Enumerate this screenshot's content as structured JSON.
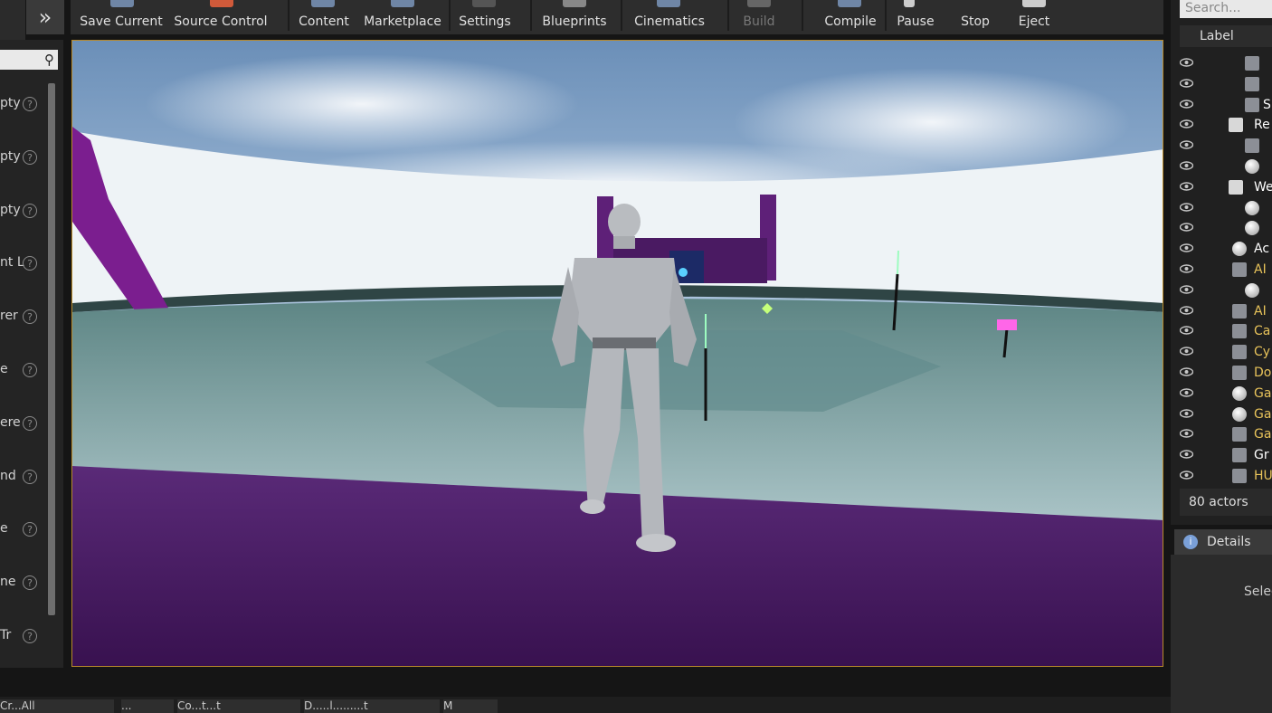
{
  "toolbar": {
    "items": [
      {
        "label": "Save Current"
      },
      {
        "label": "Source Control"
      },
      {
        "label": "Content"
      },
      {
        "label": "Marketplace"
      },
      {
        "label": "Settings"
      },
      {
        "label": "Blueprints"
      },
      {
        "label": "Cinematics"
      },
      {
        "label": "Build",
        "disabled": true
      },
      {
        "label": "Compile"
      },
      {
        "label": "Pause"
      },
      {
        "label": "Stop"
      },
      {
        "label": "Eject"
      }
    ],
    "expand_icon": "double-chevron-right-icon"
  },
  "details_panel": {
    "rows": [
      {
        "label": "pty"
      },
      {
        "label": "pty"
      },
      {
        "label": "pty"
      },
      {
        "label": "nt L"
      },
      {
        "label": "rer"
      },
      {
        "label": "e"
      },
      {
        "label": "ere"
      },
      {
        "label": "nd"
      },
      {
        "label": "e"
      },
      {
        "label": "ne"
      },
      {
        "label": "Tr"
      }
    ],
    "help_glyph": "?"
  },
  "outliner": {
    "search_placeholder": "Search...",
    "column_label": "Label",
    "rows": [
      {
        "text": "",
        "color": "#ffffff",
        "icon": "actor-cube-icon"
      },
      {
        "text": "",
        "color": "#ffffff",
        "icon": "actor-cube-icon"
      },
      {
        "text": "S",
        "color": "#ffffff",
        "icon": "sky-light-icon"
      },
      {
        "text": "Re",
        "color": "#ffffff",
        "icon": "folder-icon"
      },
      {
        "text": "",
        "color": "#ffffff",
        "icon": "directional-light-icon"
      },
      {
        "text": "",
        "color": "#ffffff",
        "icon": "sphere-reflection-icon"
      },
      {
        "text": "We",
        "color": "#ffffff",
        "icon": "folder-icon"
      },
      {
        "text": "",
        "color": "#ffffff",
        "icon": "sphere-icon"
      },
      {
        "text": "",
        "color": "#ffffff",
        "icon": "sphere-icon"
      },
      {
        "text": "Ac",
        "color": "#ffffff",
        "icon": "actor-sphere-icon"
      },
      {
        "text": "AI",
        "color": "#e8c35a",
        "icon": "ai-icon"
      },
      {
        "text": "",
        "color": "#ffffff",
        "icon": "sphere-icon"
      },
      {
        "text": "AI",
        "color": "#e8c35a",
        "icon": "ai-controller-icon"
      },
      {
        "text": "Ca",
        "color": "#e8c35a",
        "icon": "camera-icon"
      },
      {
        "text": "Cy",
        "color": "#e8c35a",
        "icon": "cylinder-icon"
      },
      {
        "text": "Do",
        "color": "#e8c35a",
        "icon": "document-icon"
      },
      {
        "text": "Ga",
        "color": "#e8c35a",
        "icon": "actor-sphere-icon"
      },
      {
        "text": "Ga",
        "color": "#e8c35a",
        "icon": "actor-sphere-icon"
      },
      {
        "text": "Ga",
        "color": "#e8c35a",
        "icon": "graph-icon"
      },
      {
        "text": "Gr",
        "color": "#ffffff",
        "icon": "gear-icon"
      },
      {
        "text": "HU",
        "color": "#e8c35a",
        "icon": "hud-icon"
      }
    ],
    "actor_count": "80 actors"
  },
  "details": {
    "tab_label": "Details",
    "empty_message": "Selec"
  },
  "bottom_tabs": [
    {
      "label": "Cr...All"
    },
    {
      "label": "..."
    },
    {
      "label": "Co...t...t"
    },
    {
      "label": "D.....l.........t"
    },
    {
      "label": "M"
    }
  ]
}
